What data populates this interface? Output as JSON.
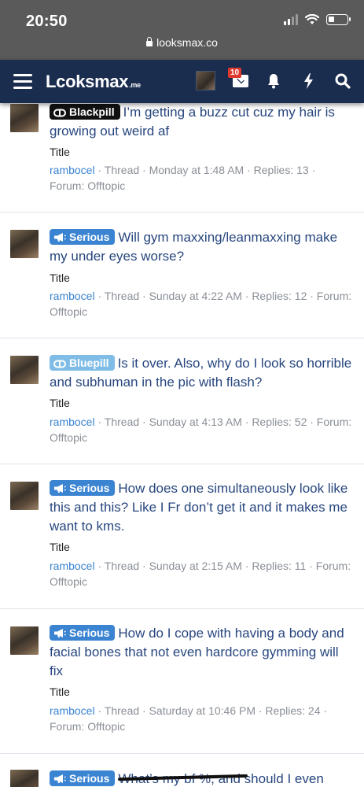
{
  "status_bar": {
    "time": "20:50",
    "url": "looksmax.co"
  },
  "nav": {
    "logo_main": "Lcoksmax",
    "logo_sub": ".me",
    "notification_count": "10"
  },
  "threads": [
    {
      "prefix": "Blackpill",
      "title": "I’m getting a buzz cut cuz my hair is growing out weird af",
      "label": "Title",
      "author": "rambocel",
      "meta": " · Thread · Monday at 1:48 AM · Replies: 13 · Forum: Offtopic"
    },
    {
      "prefix": "Serious",
      "title": "Will gym maxxing/leanmaxxing make my under eyes worse?",
      "label": "Title",
      "author": "rambocel",
      "meta": " · Thread · Sunday at 4:22 AM · Replies: 12 · Forum: Offtopic"
    },
    {
      "prefix": "Bluepill",
      "title": "Is it over. Also, why do I look so horrible and subhuman in the pic with flash?",
      "label": "Title",
      "author": "rambocel",
      "meta": " · Thread · Sunday at 4:13 AM · Replies: 52 · Forum: Offtopic"
    },
    {
      "prefix": "Serious",
      "title": "How does one simultaneously look like this and this? Like I Fr don’t get it and it makes me want to kms.",
      "label": "Title",
      "author": "rambocel",
      "meta": " · Thread · Sunday at 2:15 AM · Replies: 11 · Forum: Offtopic"
    },
    {
      "prefix": "Serious",
      "title": "How do I cope with having a body and facial bones that not even hardcore gymming will fix",
      "label": "Title",
      "author": "rambocel",
      "meta": " · Thread · Saturday at 10:46 PM · Replies: 24 · Forum: Offtopic"
    },
    {
      "prefix": "Serious",
      "title": "What’s my bf %, and should I even",
      "label": "",
      "author": "",
      "meta": ""
    }
  ],
  "colors": {
    "nav_bg": "#1b2d4f",
    "title_link": "#27467e",
    "author_link": "#3b84d1",
    "prefix_serious": "#3b84d1",
    "prefix_blackpill": "#111111",
    "prefix_bluepill": "#7fbde6"
  },
  "icons": {
    "menu": "hamburger-icon",
    "inbox": "envelope-icon",
    "alerts": "bell-icon",
    "whats_new": "bolt-icon",
    "search": "search-icon",
    "blackpill_prefix": "pill-icon",
    "serious_prefix": "megaphone-icon"
  }
}
